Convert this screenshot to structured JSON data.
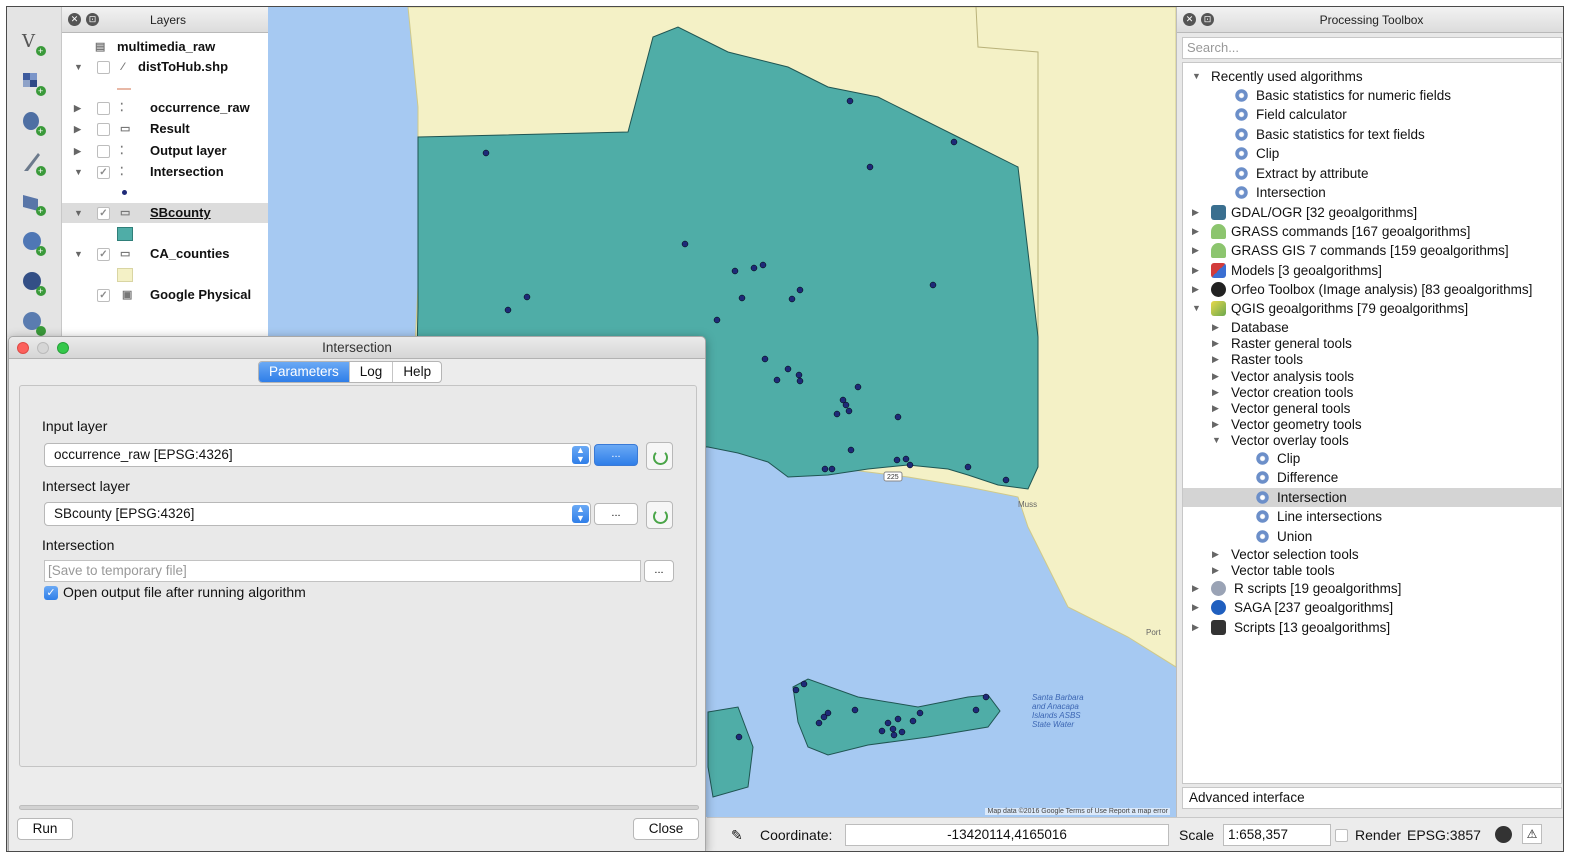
{
  "layers_panel": {
    "title": "Layers",
    "items": [
      {
        "name": "multimedia_raw"
      },
      {
        "name": "distToHub.shp"
      },
      {
        "name": "occurrence_raw"
      },
      {
        "name": "Result"
      },
      {
        "name": "Output layer"
      },
      {
        "name": "Intersection"
      },
      {
        "name": "SBcounty"
      },
      {
        "name": "CA_counties"
      },
      {
        "name": "Google Physical"
      }
    ]
  },
  "left_toolbar": {
    "icons": [
      "add-vector-layer-icon",
      "add-raster-layer-icon",
      "add-postgis-layer-icon",
      "add-delimited-text-icon",
      "add-wms-layer-icon",
      "add-wcs-layer-icon",
      "add-wfs-layer-icon",
      "add-layer-icon"
    ]
  },
  "map": {
    "attribution": "Map data ©2016 Google   Terms of Use   Report a map error",
    "place_labels": {
      "santa_barbara": "Santa Barbara and Anacapa Islands ASBS State Water",
      "highway": "225",
      "muss": "Muss",
      "port": "Port"
    },
    "colors": {
      "water": "#a6c9f2",
      "land": "#f4f1c6",
      "county_fill": "#4fada7",
      "point": "#1e2a78"
    }
  },
  "toolbox": {
    "title": "Processing Toolbox",
    "search_placeholder": "Search...",
    "recent_label": "Recently used algorithms",
    "recent": [
      "Basic statistics for numeric fields",
      "Field calculator",
      "Basic statistics for text fields",
      "Clip",
      "Extract by attribute",
      "Intersection"
    ],
    "providers": [
      {
        "label": "GDAL/OGR [32 geoalgorithms]",
        "icon": "gdal-icon"
      },
      {
        "label": "GRASS commands [167 geoalgorithms]",
        "icon": "grass-icon"
      },
      {
        "label": "GRASS GIS 7 commands [159 geoalgorithms]",
        "icon": "grass-icon"
      },
      {
        "label": "Models [3 geoalgorithms]",
        "icon": "models-icon"
      },
      {
        "label": "Orfeo Toolbox (Image analysis) [83 geoalgorithms]",
        "icon": "orfeo-icon"
      },
      {
        "label": "QGIS geoalgorithms [79 geoalgorithms]",
        "icon": "qgis-icon"
      }
    ],
    "qgis_groups_before": [
      "Database",
      "Raster general tools",
      "Raster tools",
      "Vector analysis tools",
      "Vector creation tools",
      "Vector general tools",
      "Vector geometry tools",
      "Vector overlay tools"
    ],
    "overlay_tools": [
      "Clip",
      "Difference",
      "Intersection",
      "Line intersections",
      "Union"
    ],
    "qgis_groups_after": [
      "Vector selection tools",
      "Vector table tools"
    ],
    "providers_after": [
      {
        "label": "R scripts [19 geoalgorithms]",
        "icon": "r-icon"
      },
      {
        "label": "SAGA [237 geoalgorithms]",
        "icon": "saga-icon"
      },
      {
        "label": "Scripts [13 geoalgorithms]",
        "icon": "scripts-icon"
      }
    ],
    "selected": "Intersection",
    "advanced": "Advanced interface"
  },
  "status": {
    "coordinate_label": "Coordinate:",
    "coordinate_value": "-13420114,4165016",
    "scale_label": "Scale",
    "scale_value": "1:658,357",
    "render_label": "Render",
    "crs": "EPSG:3857"
  },
  "dialog": {
    "title": "Intersection",
    "tabs": [
      "Parameters",
      "Log",
      "Help"
    ],
    "active_tab": "Parameters",
    "input_layer_label": "Input layer",
    "input_layer_value": "occurrence_raw [EPSG:4326]",
    "intersect_layer_label": "Intersect layer",
    "intersect_layer_value": "SBcounty [EPSG:4326]",
    "output_label": "Intersection",
    "output_placeholder": "[Save to temporary file]",
    "open_output_label": "Open output file after running algorithm",
    "open_output_checked": true,
    "browse_label": "...",
    "run_label": "Run",
    "close_label": "Close"
  }
}
